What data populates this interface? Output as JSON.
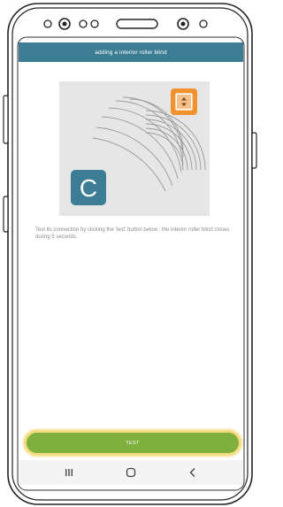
{
  "header": {
    "title": "adding a interior roller blind"
  },
  "illustration": {
    "remote_icon": "c-remote-icon",
    "blind_icon": "roller-blind-icon",
    "signal_icon": "signal-waves-icon",
    "remote_letter": "C",
    "colors": {
      "remote": "#3c7d93",
      "blind": "#f0922e",
      "background": "#e6e6e6"
    }
  },
  "instruction": {
    "text": "Test its connection by clicking the 'test' button below : the interior roller blind closes during 5 seconds."
  },
  "actions": {
    "test_label": "TEST",
    "colors": {
      "button": "#7fb03e",
      "highlight": "#f4dc80"
    }
  },
  "navbar": {
    "recent_icon": "recent-apps-icon",
    "home_icon": "home-icon",
    "back_icon": "back-icon"
  },
  "colors": {
    "accent": "#3c7d93"
  }
}
